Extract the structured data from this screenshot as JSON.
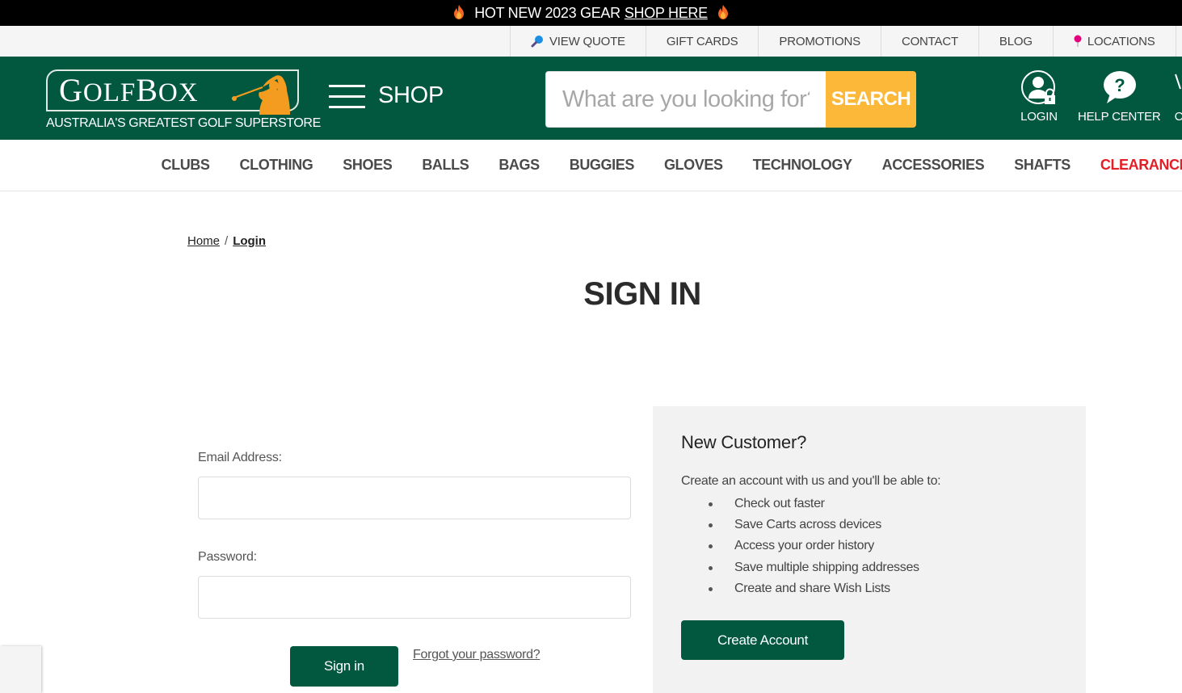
{
  "promo": {
    "text": "HOT NEW 2023 GEAR",
    "link": "SHOP HERE",
    "icon": "flame-icon"
  },
  "utility_nav": [
    {
      "label": "VIEW QUOTE",
      "icon": "magnifier-icon"
    },
    {
      "label": "GIFT CARDS"
    },
    {
      "label": "PROMOTIONS"
    },
    {
      "label": "CONTACT"
    },
    {
      "label": "BLOG"
    },
    {
      "label": "LOCATIONS",
      "icon": "map-pin-icon"
    }
  ],
  "header": {
    "logo_text_first": "G",
    "logo_text_mid": "OLF",
    "logo_text_b": "B",
    "logo_text_end": "OX",
    "tagline": "AUSTRALIA'S GREATEST GOLF SUPERSTORE",
    "shop_label": "SHOP",
    "search_placeholder": "What are you looking for?",
    "search_value": "",
    "search_button": "SEARCH",
    "actions": [
      {
        "label": "LOGIN",
        "icon": "user-lock-icon"
      },
      {
        "label": "HELP CENTER",
        "icon": "help-bubble-icon"
      },
      {
        "label": "C",
        "icon": "partial-icon"
      }
    ]
  },
  "categories": [
    {
      "label": "CLUBS"
    },
    {
      "label": "CLOTHING"
    },
    {
      "label": "SHOES"
    },
    {
      "label": "BALLS"
    },
    {
      "label": "BAGS"
    },
    {
      "label": "BUGGIES"
    },
    {
      "label": "GLOVES"
    },
    {
      "label": "TECHNOLOGY"
    },
    {
      "label": "ACCESSORIES"
    },
    {
      "label": "SHAFTS"
    },
    {
      "label": "CLEARANCE",
      "highlight": true
    }
  ],
  "colors": {
    "brand_green": "#02583f",
    "search_yellow": "#fbb839",
    "clearance_red": "#e21f26"
  },
  "breadcrumb": [
    {
      "label": "Home"
    },
    {
      "label": "Login",
      "current": true
    }
  ],
  "breadcrumb_separator": "/",
  "page_title": "SIGN IN",
  "login_form": {
    "email_label": "Email Address:",
    "email_value": "",
    "password_label": "Password:",
    "password_value": "",
    "submit_label": "Sign in",
    "forgot_label": "Forgot your password?"
  },
  "new_customer": {
    "heading": "New Customer?",
    "intro": "Create an account with us and you'll be able to:",
    "benefits": [
      "Check out faster",
      "Save Carts across devices",
      "Access your order history",
      "Save multiple shipping addresses",
      "Create and share Wish Lists"
    ],
    "button_label": "Create Account"
  }
}
